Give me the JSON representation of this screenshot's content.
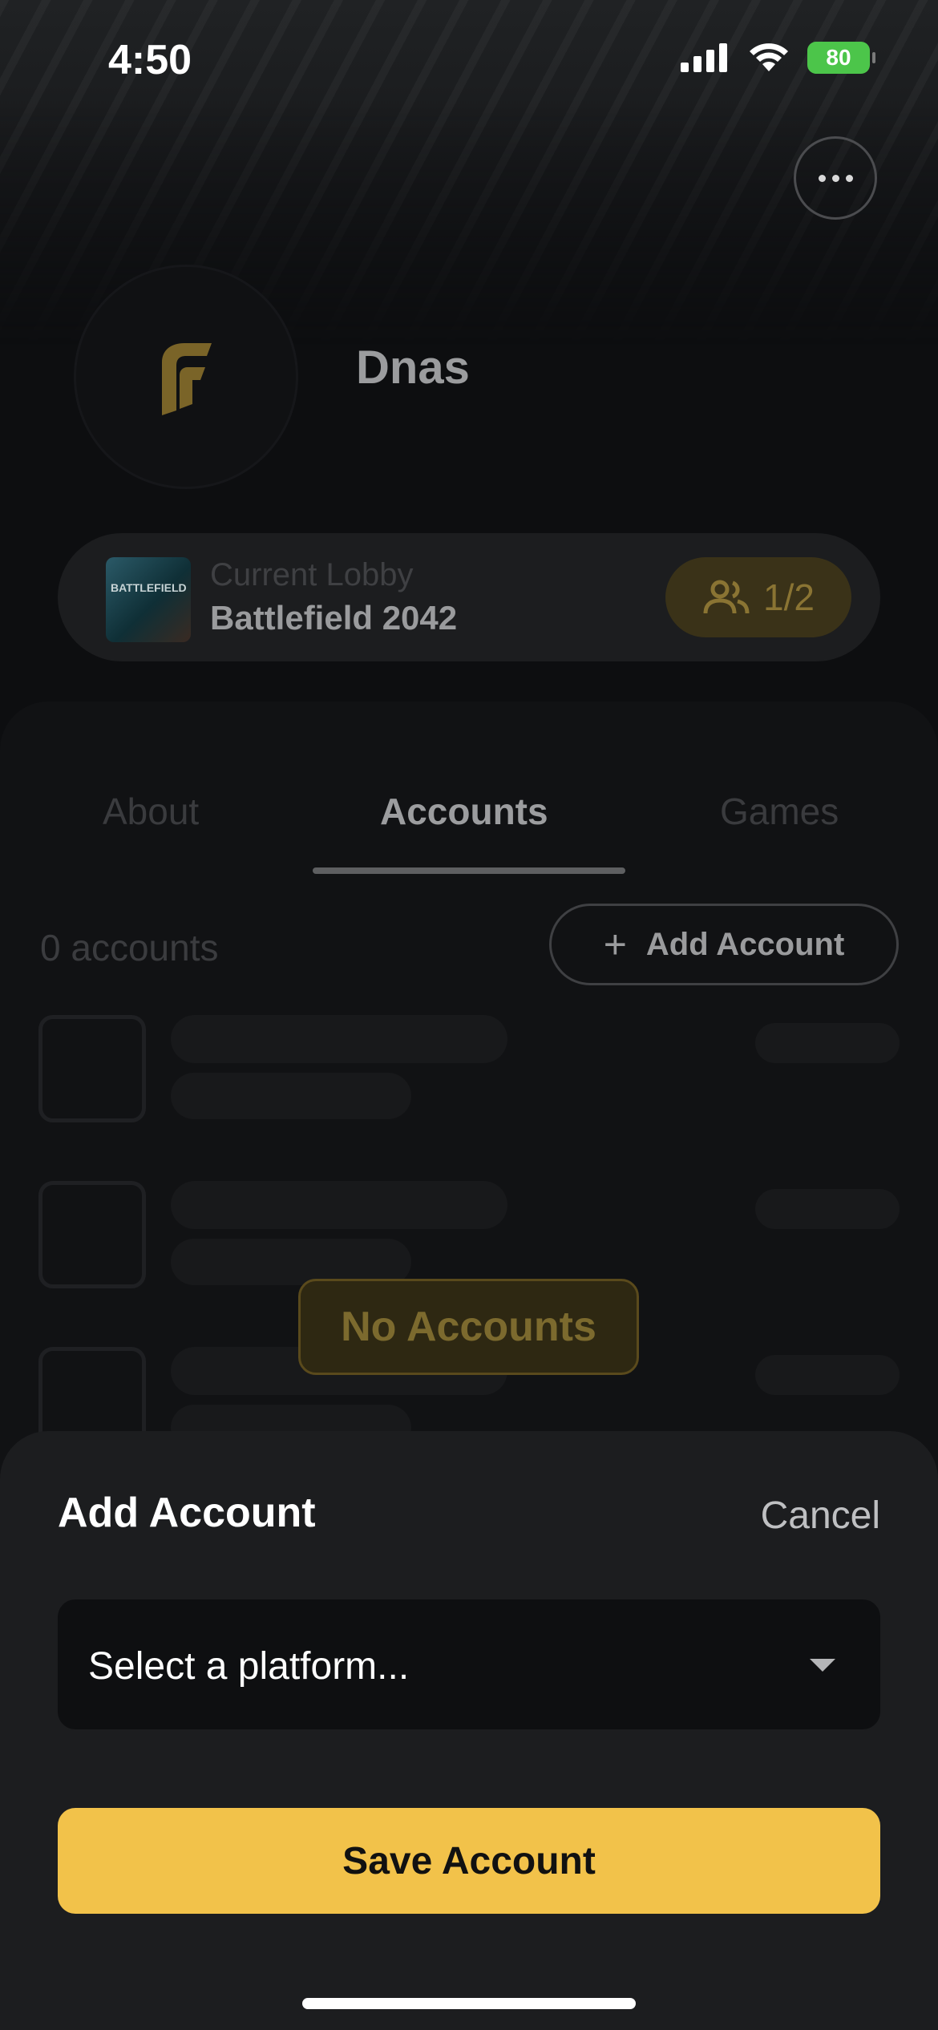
{
  "status_bar": {
    "time": "4:50",
    "battery_percent": "80"
  },
  "profile": {
    "username": "Dnas"
  },
  "lobby": {
    "label": "Current Lobby",
    "game": "Battlefield 2042",
    "thumb_text": "BATTLEFIELD",
    "count": "1/2"
  },
  "tabs": [
    {
      "label": "About"
    },
    {
      "label": "Accounts"
    },
    {
      "label": "Games"
    }
  ],
  "accounts": {
    "count_text": "0 accounts",
    "add_button_label": "Add Account",
    "empty_label": "No Accounts"
  },
  "sheet": {
    "title": "Add Account",
    "cancel_label": "Cancel",
    "platform_placeholder": "Select a platform...",
    "save_label": "Save Account"
  },
  "colors": {
    "accent": "#F2C24A",
    "sheet_bg": "#1C1D1F",
    "background": "#0D0E10"
  }
}
